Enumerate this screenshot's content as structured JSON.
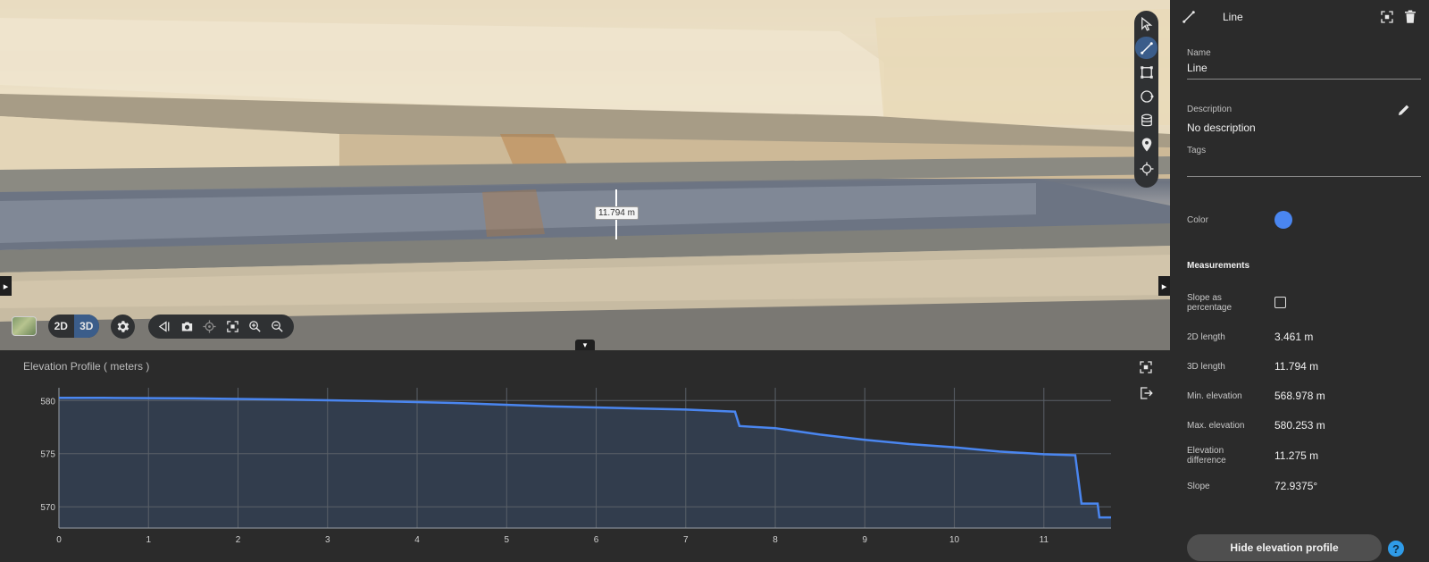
{
  "viewport": {
    "measurement_label": "11.794 m",
    "dim_toggle": {
      "options": [
        "2D",
        "3D"
      ],
      "selected": "3D"
    },
    "tools": [
      "select-pointer-icon",
      "line-measure-icon",
      "area-measure-icon",
      "circle-measure-icon",
      "volume-measure-icon",
      "location-pin-icon",
      "crosshair-icon"
    ],
    "active_tool": "line-measure-icon",
    "view_tools": [
      "toggle-sidebar-icon",
      "camera-icon",
      "locate-icon",
      "fit-view-icon",
      "zoom-in-icon",
      "zoom-out-icon"
    ]
  },
  "profile": {
    "title": "Elevation Profile ( meters )"
  },
  "chart_data": {
    "type": "area",
    "title": "Elevation Profile ( meters )",
    "xlabel": "",
    "ylabel": "",
    "x_ticks": [
      "0",
      "1",
      "2",
      "3",
      "4",
      "5",
      "6",
      "7",
      "8",
      "9",
      "10",
      "11"
    ],
    "y_ticks": [
      "570",
      "575",
      "580"
    ],
    "xlim": [
      0,
      11.75
    ],
    "ylim": [
      568,
      581.2
    ],
    "grid": true,
    "line_color": "#4a86f0",
    "fill_color": "#323d4d",
    "x": [
      0,
      0.5,
      1.5,
      2.5,
      3.5,
      4.5,
      5.5,
      6.5,
      7.0,
      7.55,
      7.6,
      8.0,
      8.5,
      9.0,
      9.5,
      10.0,
      10.5,
      11.0,
      11.35,
      11.42,
      11.6,
      11.62,
      11.75
    ],
    "y": [
      580.25,
      580.25,
      580.2,
      580.1,
      579.95,
      579.75,
      579.45,
      579.25,
      579.15,
      578.95,
      577.6,
      577.4,
      576.8,
      576.3,
      575.9,
      575.6,
      575.2,
      574.95,
      574.85,
      570.3,
      570.3,
      569.0,
      569.0
    ]
  },
  "panel": {
    "title": "Line",
    "name_label": "Name",
    "name_value": "Line",
    "description_label": "Description",
    "description_value": "No description",
    "tags_label": "Tags",
    "tags_value": "",
    "color_label": "Color",
    "color_value": "#4a86f0",
    "measurements_heading": "Measurements",
    "slope_pct_label": "Slope as percentage",
    "slope_pct_checked": false,
    "measurements": [
      {
        "label": "2D length",
        "value": "3.461 m"
      },
      {
        "label": "3D length",
        "value": "11.794 m"
      },
      {
        "label": "Min. elevation",
        "value": "568.978 m"
      },
      {
        "label": "Max. elevation",
        "value": "580.253 m"
      },
      {
        "label": "Elevation difference",
        "value": "11.275 m"
      },
      {
        "label": "Slope",
        "value": "72.9375°"
      }
    ],
    "hide_button": "Hide elevation profile",
    "help_label": "?"
  }
}
